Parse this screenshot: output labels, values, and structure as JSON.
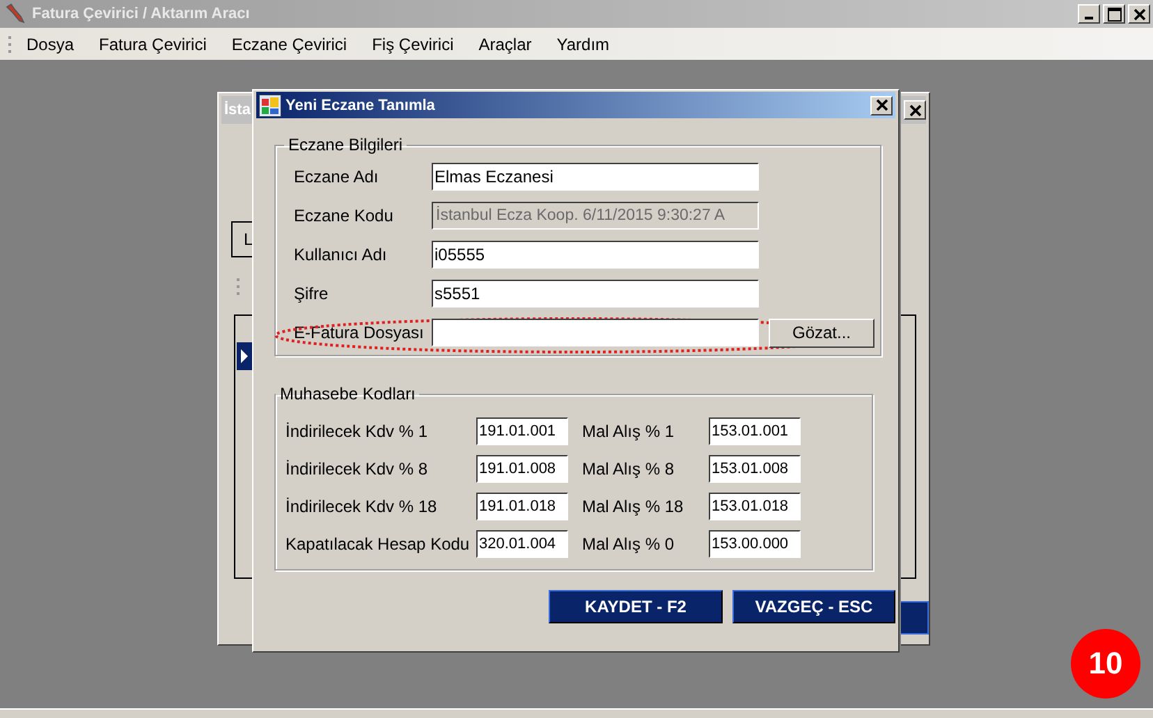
{
  "window": {
    "title": "Fatura Çevirici / Aktarım Aracı"
  },
  "menu": [
    {
      "label": "Dosya"
    },
    {
      "label": "Fatura Çevirici"
    },
    {
      "label": "Eczane Çevirici"
    },
    {
      "label": "Fiş Çevirici"
    },
    {
      "label": "Araçlar"
    },
    {
      "label": "Yardım"
    }
  ],
  "background_window": {
    "title": "İsta",
    "label": "L"
  },
  "dialog": {
    "title": "Yeni Eczane Tanımla",
    "info_group": {
      "title": "Eczane Bilgileri",
      "fields": [
        {
          "label": "Eczane Adı",
          "value": "Elmas Eczanesi",
          "disabled": false
        },
        {
          "label": "Eczane Kodu",
          "value": "İstanbul Ecza Koop. 6/11/2015 9:30:27 A",
          "disabled": true
        },
        {
          "label": "Kullanıcı Adı",
          "value": "i05555",
          "disabled": false
        },
        {
          "label": "Şifre",
          "value": "s5551",
          "disabled": false
        },
        {
          "label": "E-Fatura Dosyası",
          "disabled": false,
          "highlighted": true,
          "button": "Gözat..."
        }
      ]
    },
    "accounting_group": {
      "title": "Muhasebe Kodları",
      "rows": [
        {
          "label": "İndirilecek Kdv  % 1",
          "code": "191.01.001",
          "label_2": "Mal Alış  % 1",
          "code_2": "153.01.001"
        },
        {
          "label": "İndirilecek Kdv  % 8",
          "code": "191.01.008",
          "label_2": "Mal Alış  % 8",
          "code_2": "153.01.008"
        },
        {
          "label": "İndirilecek Kdv  % 18",
          "code": "191.01.018",
          "label_2": "Mal Alış  % 18",
          "code_2": "153.01.018"
        },
        {
          "label": "Kapatılacak Hesap Kodu",
          "code": "320.01.004",
          "label_2": "Mal Alış  % 0",
          "code_2": "153.00.000"
        }
      ]
    },
    "buttons": [
      {
        "label": "KAYDET - F2"
      },
      {
        "label": "VAZGEÇ - ESC"
      }
    ]
  },
  "step_badge": "10"
}
